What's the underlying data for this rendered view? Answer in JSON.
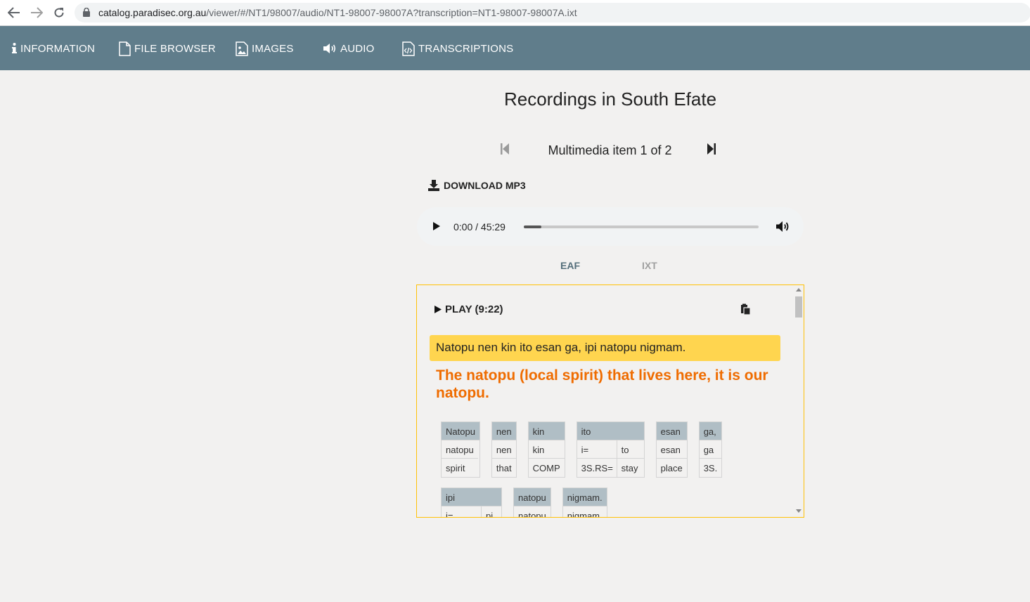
{
  "browser": {
    "url_host": "catalog.paradisec.org.au",
    "url_path": "/viewer/#/NT1/98007/audio/NT1-98007-98007A?transcription=NT1-98007-98007A.ixt"
  },
  "nav": {
    "items": [
      {
        "label": "INFORMATION",
        "icon": "info-icon"
      },
      {
        "label": "FILE BROWSER",
        "icon": "file-icon"
      },
      {
        "label": "IMAGES",
        "icon": "image-icon"
      },
      {
        "label": "AUDIO",
        "icon": "volume-icon"
      },
      {
        "label": "TRANSCRIPTIONS",
        "icon": "code-file-icon"
      }
    ]
  },
  "main": {
    "title": "Recordings in South Efate",
    "pager_label": "Multimedia item 1 of 2",
    "download_label": "DOWNLOAD MP3",
    "player": {
      "time": "0:00 / 45:29",
      "progress": 0.075
    },
    "format_tabs": [
      {
        "label": "EAF",
        "active": true
      },
      {
        "label": "IXT",
        "active": false
      }
    ]
  },
  "transcript": {
    "play_label": "PLAY (9:22)",
    "vernacular": "Natopu nen kin ito esan ga, ipi natopu nigmam.",
    "translation": "The natopu (local spirit) that lives here, it is our natopu.",
    "row1": [
      {
        "word": "Natopu",
        "morphs": [
          {
            "form": "natopu",
            "gloss": "spirit"
          }
        ]
      },
      {
        "word": "nen",
        "morphs": [
          {
            "form": "nen",
            "gloss": "that"
          }
        ]
      },
      {
        "word": "kin",
        "morphs": [
          {
            "form": "kin",
            "gloss": "COMP"
          }
        ]
      },
      {
        "word": "ito",
        "morphs": [
          {
            "form": "i=",
            "gloss": "3S.RS="
          },
          {
            "form": "to",
            "gloss": "stay"
          }
        ]
      },
      {
        "word": "esan",
        "morphs": [
          {
            "form": "esan",
            "gloss": "place"
          }
        ]
      },
      {
        "word": "ga,",
        "morphs": [
          {
            "form": "ga",
            "gloss": "3S."
          }
        ]
      }
    ],
    "row2": [
      {
        "word": "ipi",
        "morphs": [
          {
            "form": "i=",
            "gloss": ""
          },
          {
            "form": "pi",
            "gloss": ""
          }
        ]
      },
      {
        "word": "natopu",
        "morphs": [
          {
            "form": "natopu",
            "gloss": ""
          }
        ]
      },
      {
        "word": "nigmam.",
        "morphs": [
          {
            "form": "nigmam",
            "gloss": ""
          }
        ]
      }
    ]
  },
  "colors": {
    "nav_bg": "#607d8b",
    "highlight": "#ffd54f",
    "translation": "#ef6c00",
    "gloss_head": "#b0bec5",
    "panel_border": "#ffc107"
  }
}
